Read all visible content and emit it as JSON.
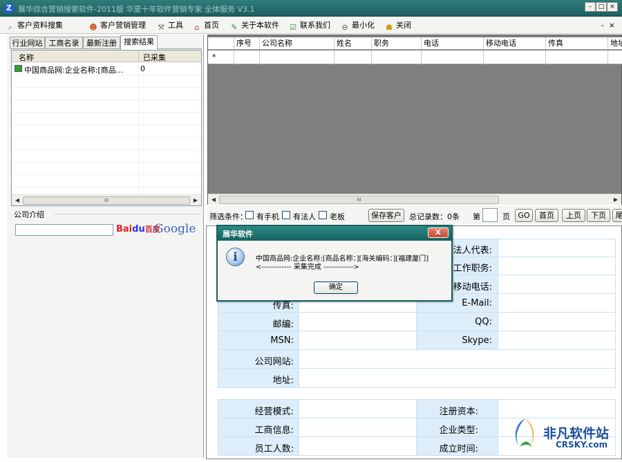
{
  "window": {
    "title": "展华综合营销搜索软件-2011版 华夏十年软件营销专家 全体服务 V3.1",
    "app_icon": "Z",
    "min": "–",
    "max": "□",
    "close": "×"
  },
  "menu": {
    "items": [
      {
        "label": "客户资料搜集",
        "icon": "search-icon"
      },
      {
        "label": "客户营销管理",
        "icon": "person-icon"
      },
      {
        "label": "工具",
        "icon": "tools-icon"
      },
      {
        "label": "首页",
        "icon": "home-icon"
      },
      {
        "label": "关于本软件",
        "icon": "about-icon"
      },
      {
        "label": "联系我们",
        "icon": "contact-icon"
      },
      {
        "label": "最小化",
        "icon": "minimize-icon"
      },
      {
        "label": "关闭",
        "icon": "close-icon"
      }
    ],
    "right_min": "-",
    "right_close": "×"
  },
  "left": {
    "tabs": [
      "行业网站",
      "工商名录",
      "最新注册",
      "搜索结果"
    ],
    "active_tab": 3,
    "columns": [
      "名称",
      "已采集"
    ],
    "rows": [
      {
        "name": "中国商品网:企业名称:[商品...",
        "count": "0"
      }
    ],
    "scroll_thumb": "III",
    "company_intro_label": "公司介绍",
    "search_input_value": "",
    "baidu": {
      "bai": "Bai",
      "paw": "du",
      "name": "百度"
    },
    "google": "Google"
  },
  "grid": {
    "columns": [
      "序号",
      "公司名称",
      "姓名",
      "职务",
      "电话",
      "移动电话",
      "传真",
      "地址"
    ],
    "new_row_marker": "*",
    "scroll_thumb": "III"
  },
  "filter": {
    "label": "筛选条件：",
    "checkboxes": [
      "有手机",
      "有法人",
      "老板"
    ],
    "save_button": "保存客户",
    "total_records": "总记录数：0条",
    "page_prefix": "第",
    "page_value": "",
    "page_suffix": "页",
    "go_button": "GO",
    "first_button": "首页",
    "prev_button": "上页",
    "next_button": "下页",
    "last_button": "尾"
  },
  "form": {
    "rows1": [
      {
        "left": "",
        "right": "法人代表:"
      },
      {
        "left": "",
        "right": "工作职务:"
      },
      {
        "left": "",
        "right": "移动电话:"
      },
      {
        "left": "传真:",
        "right": "E-Mail:"
      },
      {
        "left": "邮编:",
        "right": "QQ:"
      },
      {
        "left": "MSN:",
        "right": "Skype:"
      }
    ],
    "website_label": "公司网站:",
    "address_label": "地址:",
    "rows2": [
      {
        "left": "经营模式:",
        "right": "注册资本:"
      },
      {
        "left": "工商信息:",
        "right": "企业类型:"
      },
      {
        "left": "员工人数:",
        "right": "成立时间:"
      }
    ]
  },
  "dialog": {
    "title": "展华软件",
    "close": "X",
    "icon": "i",
    "message_line1": "中国商品网:企业名称:[商品名称：][海关编码：][福建厦门]",
    "message_line2": "<------------ 采集完成 ------------>",
    "ok_button": "确定"
  },
  "watermark": {
    "text": "非凡软件站",
    "url": "CRSKY.com"
  }
}
